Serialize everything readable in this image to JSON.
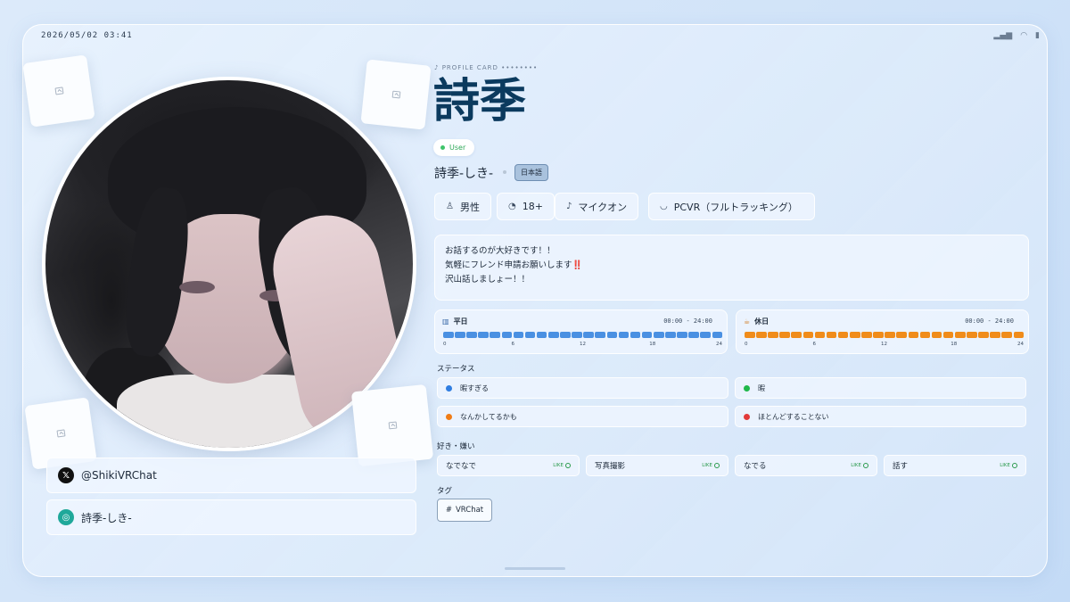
{
  "statusbar": {
    "time": "2026/05/02 03:41",
    "icons": [
      "signal-icon",
      "wifi-icon",
      "battery-icon"
    ]
  },
  "profile": {
    "kicker": "♪ PROFILE CARD ••••••••",
    "name": "詩季",
    "role": "User",
    "display_name": "詩季-しき-",
    "language": "日本語",
    "attributes": [
      {
        "icon": "person-icon",
        "label": "男性"
      },
      {
        "icon": "age-icon",
        "label": "18+"
      },
      {
        "icon": "mic-icon",
        "label": "マイクオン"
      },
      {
        "icon": "headset-icon",
        "label": "PCVR（フルトラッキング）"
      }
    ],
    "bio": [
      "お話するのが大好きです！！",
      "気軽にフレンド申請お願いします‼️",
      "沢山話しましょー！！"
    ]
  },
  "social": {
    "twitter": "@ShikiVRChat",
    "vrchat": "詩季-しき-"
  },
  "schedule": {
    "weekday": {
      "label": "平日",
      "range": "00:00 - 24:00",
      "color": "#4a90e2",
      "start": 0,
      "end": 24
    },
    "holiday": {
      "label": "休日",
      "range": "00:00 - 24:00",
      "color": "#f08c1a",
      "start": 0,
      "end": 24
    },
    "ticks": [
      "0",
      "6",
      "12",
      "18",
      "24"
    ]
  },
  "status": {
    "label": "ステータス",
    "items": [
      {
        "label": "暇すぎる",
        "color": "#2f7de1"
      },
      {
        "label": "暇",
        "color": "#1fb84a"
      },
      {
        "label": "なんかしてるかも",
        "color": "#f07c16"
      },
      {
        "label": "ほとんどすることない",
        "color": "#e23a3a"
      }
    ]
  },
  "likes": {
    "label": "好き・嫌い",
    "badge": "LIKE",
    "items": [
      "なでなで",
      "写真撮影",
      "なでる",
      "話す"
    ]
  },
  "tags": {
    "label": "タグ",
    "items": [
      "VRChat"
    ]
  }
}
